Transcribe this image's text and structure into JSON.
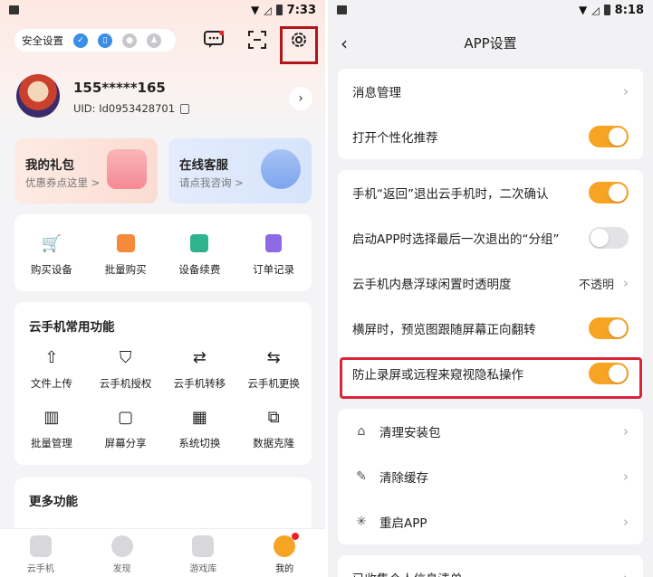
{
  "left": {
    "status": {
      "time": "7:33"
    },
    "security": {
      "label": "安全设置"
    },
    "profile": {
      "phone": "155*****165",
      "uid": "UID: Id0953428701"
    },
    "cards": [
      {
        "title": "我的礼包",
        "subtitle": "优惠券点这里 >"
      },
      {
        "title": "在线客服",
        "subtitle": "请点我咨询 >"
      }
    ],
    "quick_actions": [
      "购买设备",
      "批量购买",
      "设备续费",
      "订单记录"
    ],
    "common": {
      "title": "云手机常用功能",
      "items": [
        "文件上传",
        "云手机授权",
        "云手机转移",
        "云手机更换",
        "批量管理",
        "屏幕分享",
        "系统切换",
        "数据克隆"
      ]
    },
    "more": {
      "title": "更多功能"
    },
    "tabs": [
      "云手机",
      "发现",
      "游戏库",
      "我的"
    ]
  },
  "right": {
    "status": {
      "time": "8:18"
    },
    "title": "APP设置",
    "rows": [
      {
        "label": "消息管理"
      },
      {
        "label": "打开个性化推荐",
        "toggle": "on"
      },
      {
        "label": "手机“返回”退出云手机时，二次确认",
        "toggle": "on"
      },
      {
        "label": "启动APP时选择最后一次退出的“分组”",
        "toggle": "off"
      },
      {
        "label": "云手机内悬浮球闲置时透明度",
        "value": "不透明"
      },
      {
        "label": "横屏时，预览图跟随屏幕正向翻转",
        "toggle": "on"
      },
      {
        "label": "防止录屏或远程来窥视隐私操作",
        "toggle": "on"
      },
      {
        "label": "清理安装包"
      },
      {
        "label": "清除缓存"
      },
      {
        "label": "重启APP"
      },
      {
        "label": "已收集个人信息清单"
      }
    ]
  },
  "colors": {
    "accent": "#f7a323",
    "highlight": "#d9253a"
  }
}
